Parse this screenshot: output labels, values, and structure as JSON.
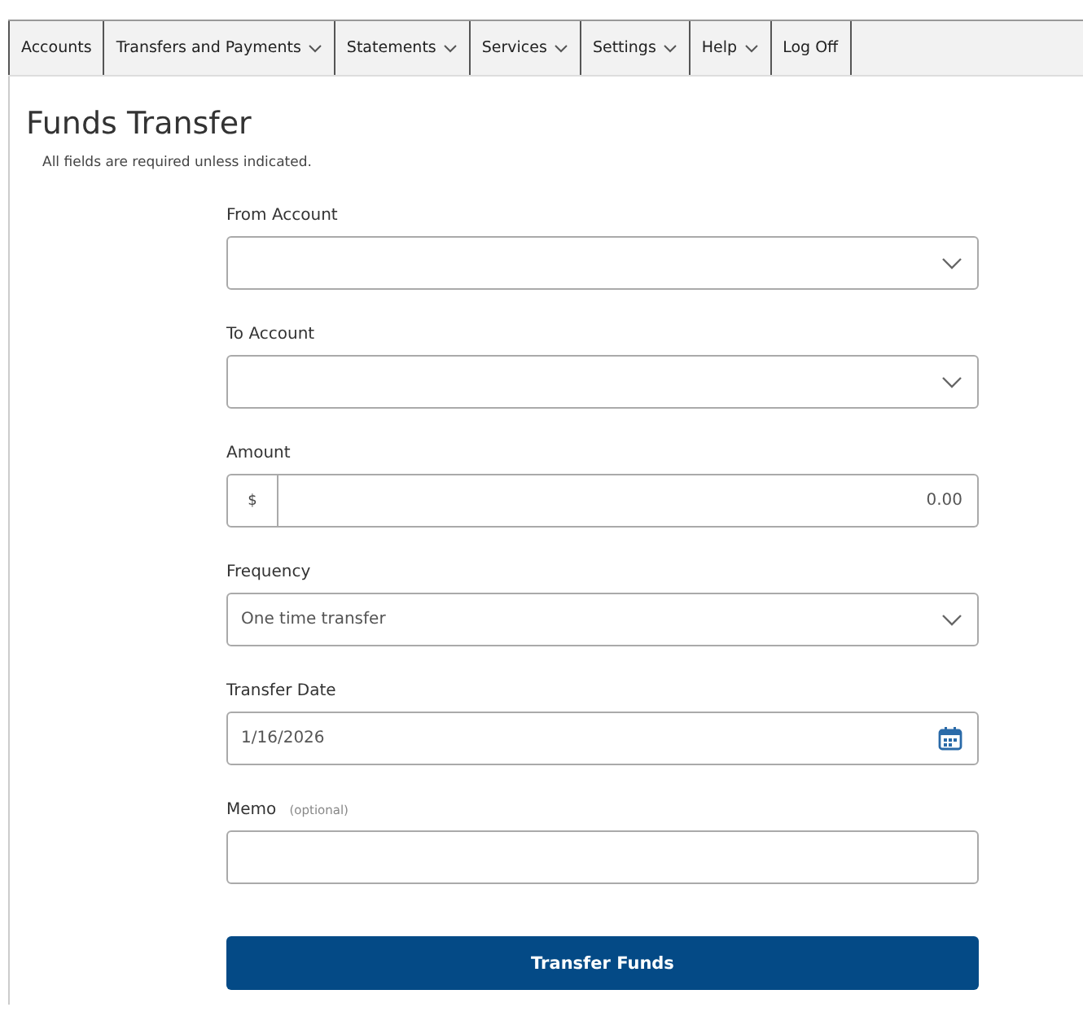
{
  "menu": [
    {
      "label": "Accounts",
      "dropdown": false
    },
    {
      "label": "Transfers and Payments",
      "dropdown": true
    },
    {
      "label": "Statements",
      "dropdown": true
    },
    {
      "label": "Services",
      "dropdown": true
    },
    {
      "label": "Settings",
      "dropdown": true
    },
    {
      "label": "Help",
      "dropdown": true
    },
    {
      "label": "Log Off",
      "dropdown": false
    }
  ],
  "title": "Funds Transfer",
  "note": "All fields are required unless indicated.",
  "fields": [
    {
      "kind": "select",
      "label": "From Account"
    },
    {
      "kind": "select",
      "label": "To Account"
    },
    {
      "kind": "currency",
      "label": "Amount",
      "prefix": "$",
      "placeholder": "0.00"
    },
    {
      "kind": "select",
      "label": "Frequency",
      "value": "One time transfer"
    },
    {
      "kind": "date",
      "label": "Transfer Date",
      "value": "1/16/2026"
    },
    {
      "kind": "text",
      "label": "Memo",
      "hint": "(optional)"
    }
  ],
  "submit": "Transfer Funds"
}
